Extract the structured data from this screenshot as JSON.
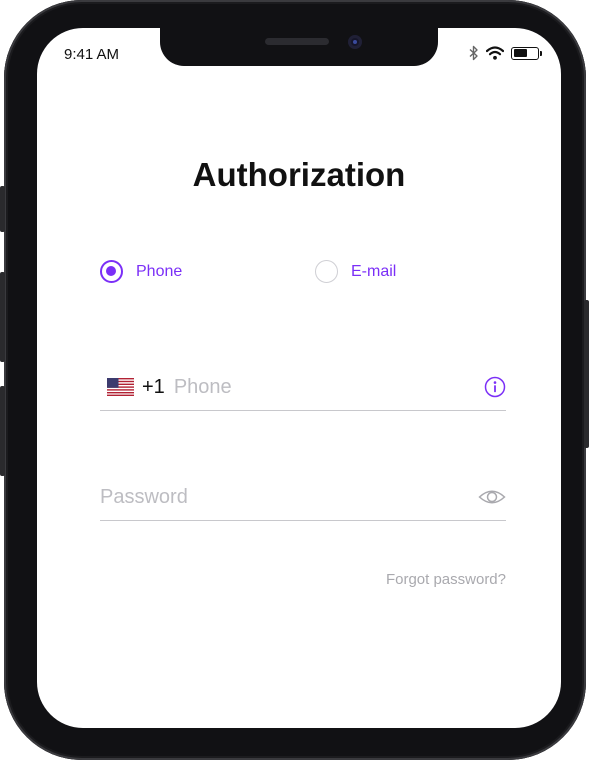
{
  "status_bar": {
    "time": "9:41 AM",
    "battery_level": 0.5
  },
  "page": {
    "title": "Authorization"
  },
  "auth_method": {
    "options": [
      {
        "label": "Phone",
        "selected": true
      },
      {
        "label": "E-mail",
        "selected": false
      }
    ]
  },
  "phone_field": {
    "country_flag": "us-flag-icon",
    "prefix": "+1",
    "value": "",
    "placeholder": "Phone",
    "trailing_icon": "info-icon"
  },
  "password_field": {
    "value": "",
    "placeholder": "Password",
    "trailing_icon": "eye-icon"
  },
  "forgot_password": {
    "label": "Forgot password?"
  },
  "colors": {
    "accent": "#7b2ff7",
    "text": "#111111",
    "placeholder": "#bdbdc2",
    "underline": "#c8c8cc",
    "muted": "#a9a9ae"
  }
}
